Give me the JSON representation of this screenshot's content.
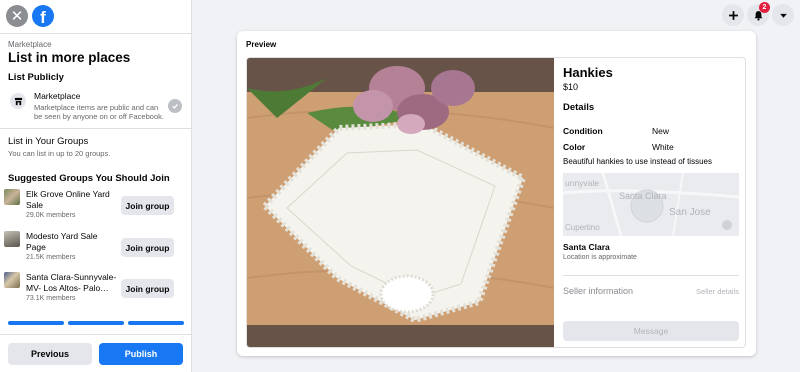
{
  "app": {
    "brand_letter": "f"
  },
  "sidebar": {
    "breadcrumb": "Marketplace",
    "title": "List in more places",
    "list_publicly": "List Publicly",
    "marketplace": {
      "title": "Marketplace",
      "description": "Marketplace items are public and can be seen by anyone on or off Facebook."
    },
    "groups": {
      "title": "List in Your Groups",
      "subtitle": "You can list in up to 20 groups."
    },
    "suggested": {
      "title": "Suggested Groups You Should Join",
      "items": [
        {
          "name": "Elk Grove Online Yard Sale",
          "members": "29.0K members",
          "join_label": "Join group"
        },
        {
          "name": "Modesto Yard Sale Page",
          "members": "21.5K members",
          "join_label": "Join group"
        },
        {
          "name": "Santa Clara-Sunnyvale-MV- Los Altos- Palo…",
          "members": "73.1K members",
          "join_label": "Join group"
        }
      ]
    },
    "footer": {
      "previous_label": "Previous",
      "publish_label": "Publish"
    }
  },
  "topbar": {
    "notification_count": "2"
  },
  "preview": {
    "label": "Preview",
    "item_title": "Hankies",
    "price": "$10",
    "details_heading": "Details",
    "condition": {
      "label": "Condition",
      "value": "New"
    },
    "color": {
      "label": "Color",
      "value": "White"
    },
    "description": "Beautiful hankies to use instead of tissues",
    "map_labels": {
      "sunnyvale": "unnyvale",
      "santa_clara": "Santa Clara",
      "san_jose": "San Jose",
      "cupertino": "Cupertino"
    },
    "location": "Santa Clara",
    "location_note": "Location is approximate",
    "seller_heading": "Seller information",
    "seller_link": "Seller details",
    "message_label": "Message"
  },
  "colors": {
    "accent": "#1877f2",
    "badge": "#e41e3f",
    "button_gray": "#e4e6eb"
  }
}
